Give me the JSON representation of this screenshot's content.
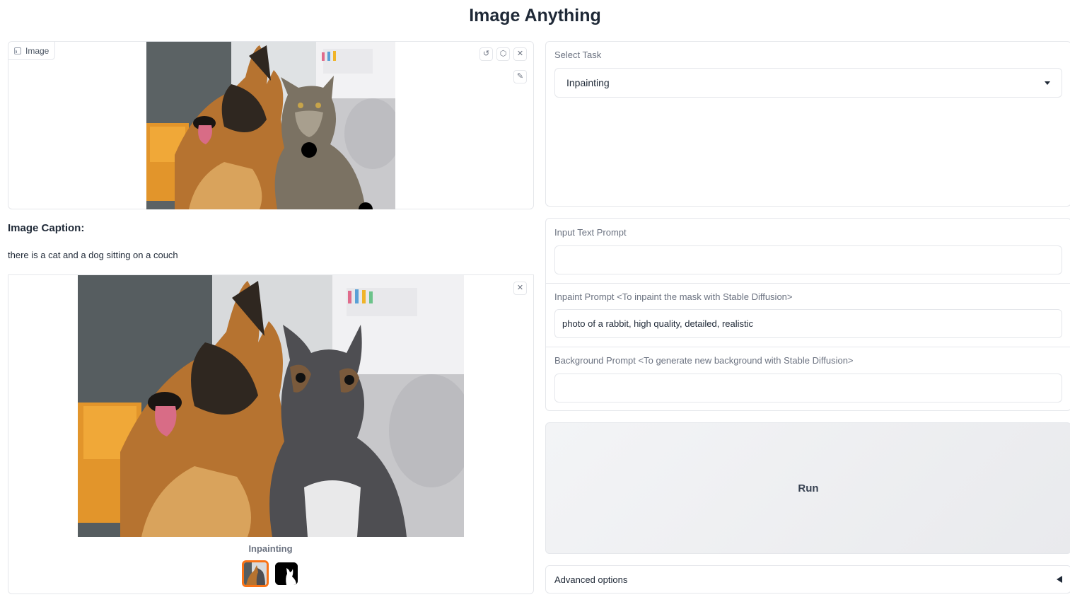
{
  "app": {
    "title": "Image Anything"
  },
  "image_input": {
    "label": "Image",
    "icons": [
      "undo-icon",
      "eraser-icon",
      "close-icon",
      "brush-icon"
    ]
  },
  "caption": {
    "label": "Image Caption:",
    "text": "there is a cat and a dog sitting on a couch"
  },
  "gallery": {
    "label": "Inpainting",
    "thumbnails": [
      "result-thumbnail",
      "mask-thumbnail"
    ],
    "selected_index": 0
  },
  "task": {
    "label": "Select Task",
    "value": "Inpainting"
  },
  "text_prompt": {
    "label": "Input Text Prompt",
    "value": ""
  },
  "inpaint_prompt": {
    "label": "Inpaint Prompt <To inpaint the mask with Stable Diffusion>",
    "value": "photo of a rabbit, high quality, detailed, realistic"
  },
  "background_prompt": {
    "label": "Background Prompt <To generate new background with Stable Diffusion>",
    "value": ""
  },
  "run": {
    "label": "Run"
  },
  "advanced": {
    "label": "Advanced options"
  },
  "colors": {
    "accent": "#f97316",
    "border": "#e5e7eb",
    "label_gray": "#6b7280"
  }
}
